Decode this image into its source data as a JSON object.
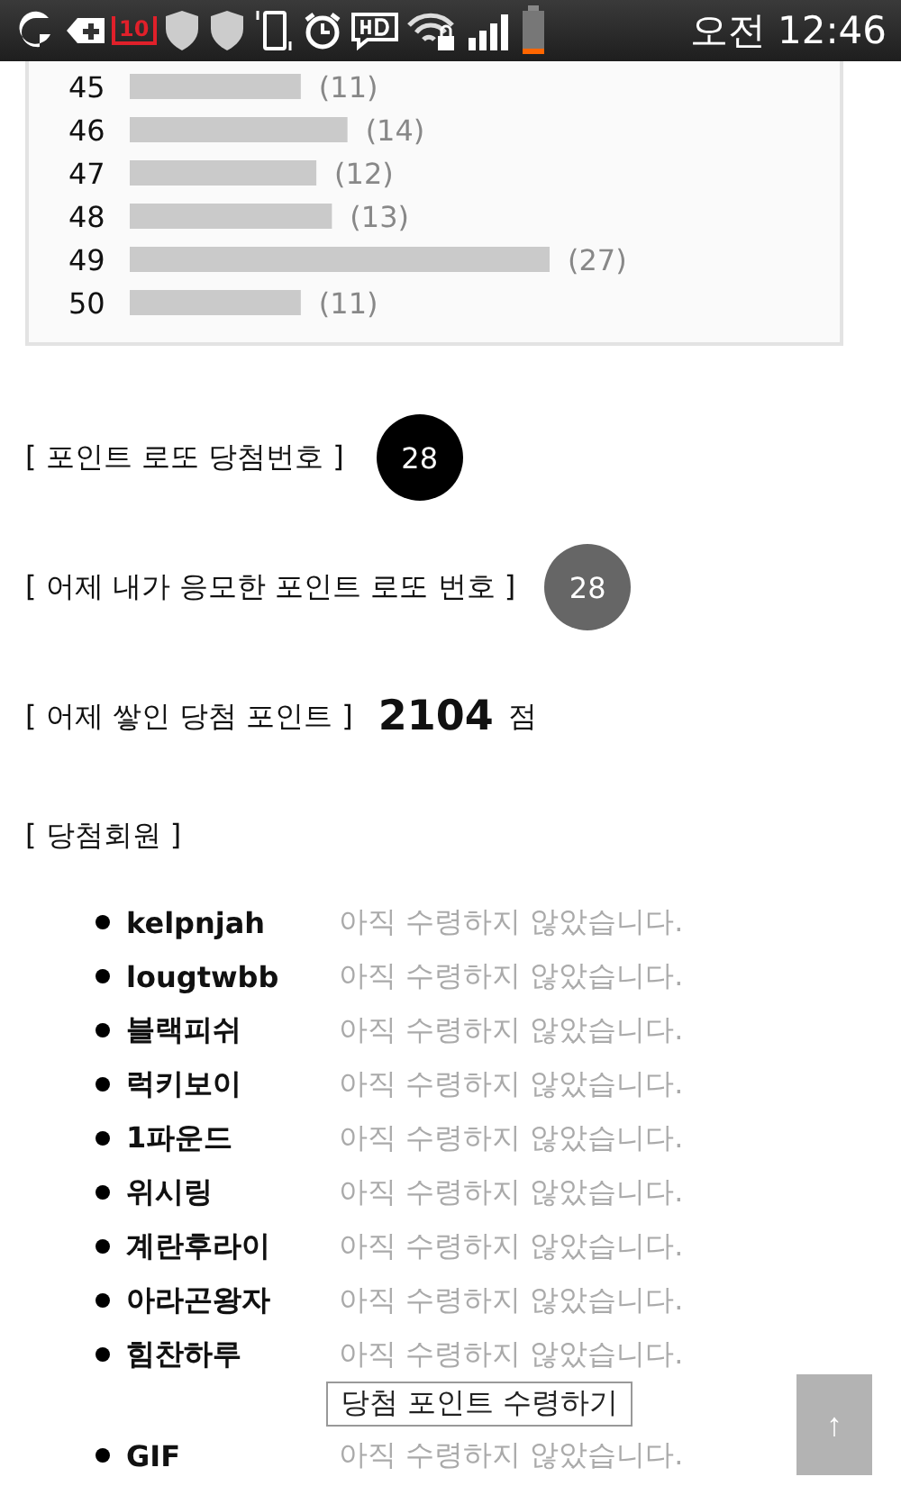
{
  "status_bar": {
    "notification_count": "10",
    "time": "오전 12:46"
  },
  "chart": {
    "chart_data": {
      "type": "bar",
      "orientation": "horizontal",
      "categories": [
        "45",
        "46",
        "47",
        "48",
        "49",
        "50"
      ],
      "values": [
        11,
        14,
        12,
        13,
        27,
        11
      ],
      "value_labels": [
        "(11)",
        "(14)",
        "(12)",
        "(13)",
        "(27)",
        "(11)"
      ]
    }
  },
  "winning_number": {
    "label": "[ 포인트 로또 당첨번호 ]",
    "number": "28"
  },
  "my_number": {
    "label": "[ 어제 내가 응모한 포인트 로또 번호 ]",
    "number": "28"
  },
  "accumulated": {
    "label": "[ 어제 쌓인 당첨 포인트 ]",
    "points": "2104",
    "unit": "점"
  },
  "winners": {
    "title": "[ 당첨회원 ]",
    "members": [
      {
        "name": "kelpnjah",
        "status": "아직 수령하지 않았습니다."
      },
      {
        "name": "lougtwbb",
        "status": "아직 수령하지 않았습니다."
      },
      {
        "name": "블랙피쉬",
        "status": "아직 수령하지 않았습니다."
      },
      {
        "name": "럭키보이",
        "status": "아직 수령하지 않았습니다."
      },
      {
        "name": "1파운드",
        "status": "아직 수령하지 않았습니다."
      },
      {
        "name": "위시링",
        "status": "아직 수령하지 않았습니다."
      },
      {
        "name": "계란후라이",
        "status": "아직 수령하지 않았습니다."
      },
      {
        "name": "아라곤왕자",
        "status": "아직 수령하지 않았습니다."
      },
      {
        "name": "힘찬하루",
        "status": "아직 수령하지 않았습니다.",
        "claim_button": "당첨 포인트 수령하기"
      },
      {
        "name": "GIF",
        "status": "아직 수령하지 않았습니다."
      }
    ]
  },
  "scroll_top_button": "↑"
}
